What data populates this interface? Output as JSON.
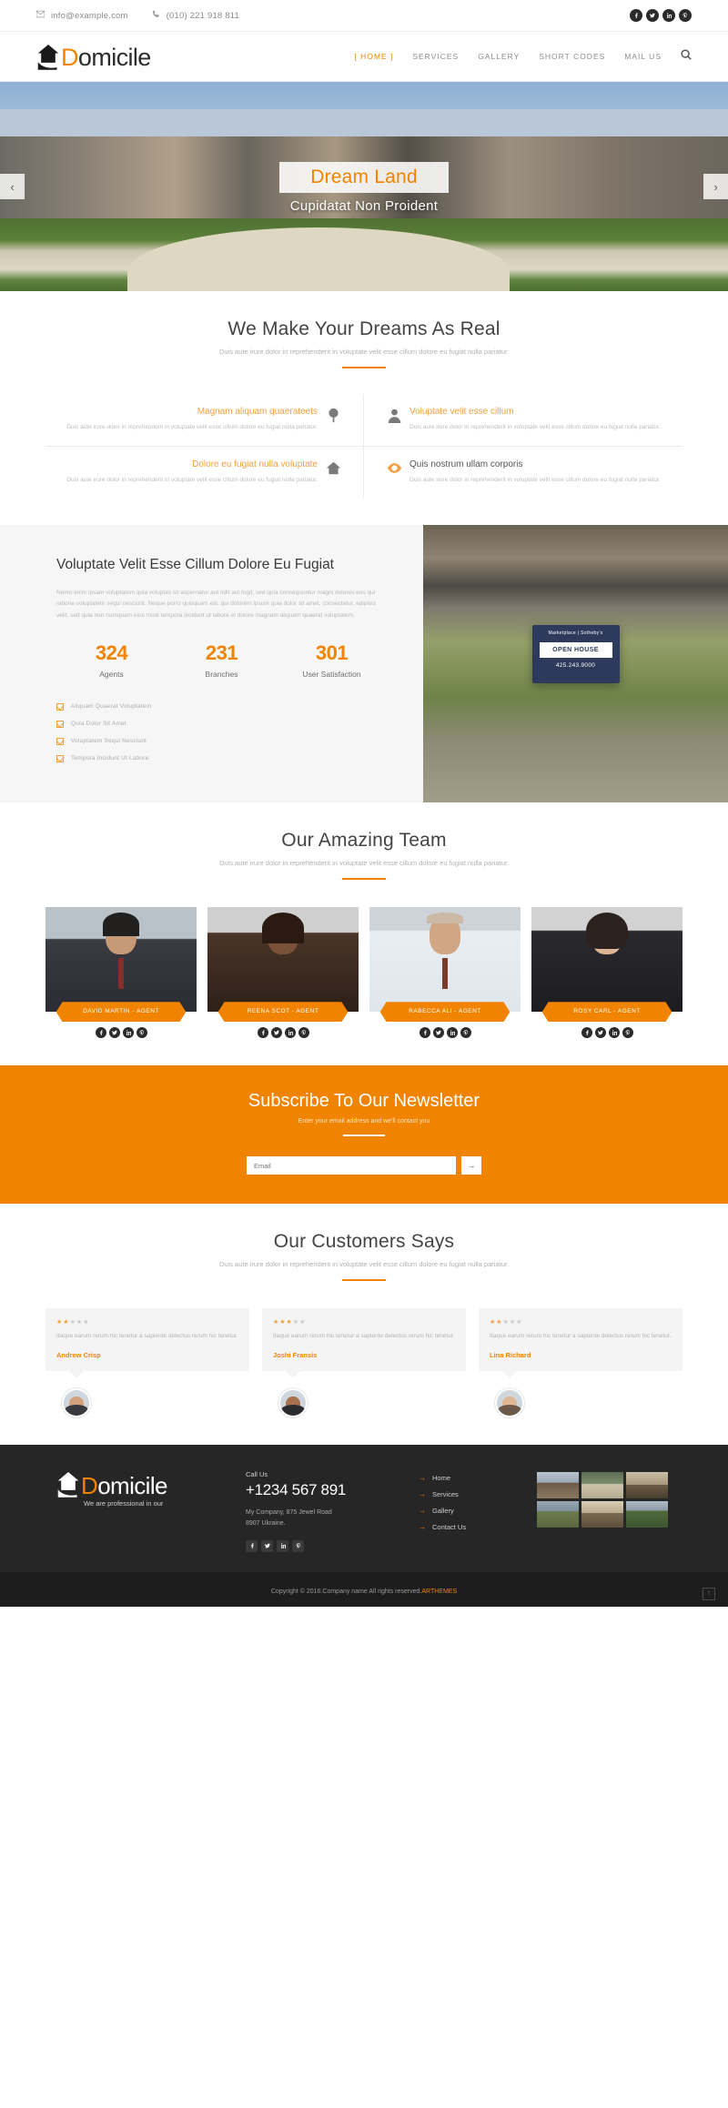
{
  "topbar": {
    "email": "info@example.com",
    "phone": "(010) 221 918 811",
    "socials": [
      "facebook-icon",
      "twitter-icon",
      "linkedin-icon",
      "pinterest-icon"
    ]
  },
  "header": {
    "logo_d": "D",
    "logo_rest": "omicile",
    "nav": [
      {
        "label": "[ HOME ]",
        "active": true
      },
      {
        "label": "SERVICES",
        "active": false
      },
      {
        "label": "GALLERY",
        "active": false
      },
      {
        "label": "SHORT CODES",
        "active": false
      },
      {
        "label": "MAIL US",
        "active": false
      }
    ],
    "search_icon": "search-icon"
  },
  "hero": {
    "title": "Dream Land",
    "subtitle": "Cupidatat Non Proident",
    "prev": "‹",
    "next": "›"
  },
  "services": {
    "title": "We Make Your Dreams As Real",
    "subtitle": "Duis aute irure dolor in reprehenderit in voluptate velit esse cillum dolore eu fugiat nulla pariatur.",
    "items": [
      {
        "title": "Magnam aliquam quaerateets",
        "desc": "Duis aute irure dolor in reprehenderit in voluptate velit esse cillum dolore eu fugiat nulla pariatur.",
        "icon": "tree-icon"
      },
      {
        "title": "Voluptate velit esse cillum",
        "desc": "Duis aute irure dolor in reprehenderit in voluptate velit esse cillum dolore eu fugiat nulla pariatur.",
        "icon": "user-icon"
      },
      {
        "title": "Dolore eu fugiat nulla voluptate",
        "desc": "Duis aute irure dolor in reprehenderit in voluptate velit esse cillum dolore eu fugiat nulla pariatur.",
        "icon": "home-icon"
      },
      {
        "title": "Quis nostrum ullam corporis",
        "desc": "Duis aute irure dolor in reprehenderit in voluptate velit esse cillum dolore eu fugiat nulla pariatur.",
        "icon": "eye-icon"
      }
    ]
  },
  "about": {
    "title": "Voluptate Velit Esse Cillum Dolore Eu Fugiat",
    "desc": "Nemo enim ipsam voluptatem quia voluptas sit aspernatur aut odit aut fugit, sed quia consequuntur magni dolores eos qui ratione voluptatem sequi nesciunt. Neque porro quisquam est, qui dolorem ipsum quia dolor sit amet, consectetur, adipisci velit, sed quia non numquam eius modi tempora incidunt ut labore et dolore magnam aliquam quaerat voluptatem.",
    "counters": [
      {
        "num": "324",
        "label": "Agents"
      },
      {
        "num": "231",
        "label": "Branches"
      },
      {
        "num": "301",
        "label": "User Satisfaction"
      }
    ],
    "checks": [
      "Aliquam Quaerat Voluptatem",
      "Quia Dolor Sit Amet",
      "Voluptatem Sequi Nesciunt",
      "Tempora Incidunt Ut Labore"
    ],
    "sign": {
      "brand": "Marketplace | Sotheby's",
      "headline": "OPEN HOUSE",
      "phone": "425.243.9000"
    }
  },
  "team": {
    "title": "Our Amazing Team",
    "subtitle": "Duis aute irure dolor in reprehenderit in voluptate velit esse cillum dolore eu fugiat nulla pariatur.",
    "members": [
      {
        "name": "DAVID MARTIN - AGENT"
      },
      {
        "name": "REENA SCOT - AGENT"
      },
      {
        "name": "RABECCA ALI - AGENT"
      },
      {
        "name": "ROSY CARL - AGENT"
      }
    ],
    "socials": [
      "facebook-icon",
      "twitter-icon",
      "linkedin-icon",
      "pinterest-icon"
    ]
  },
  "newsletter": {
    "title": "Subscribe To Our Newsletter",
    "subtitle": "Enter your email address and we'll contact you",
    "placeholder": "Email",
    "submit": "→"
  },
  "testimonials": {
    "title": "Our Customers Says",
    "subtitle": "Duis aute irure dolor in reprehenderit in voluptate velit esse cillum dolore eu fugiat nulla pariatur.",
    "items": [
      {
        "stars_on": 2,
        "stars_total": 5,
        "text": "Itaque earum rerum hic tenetur a sapiente delectus rerum hic tenetur.",
        "name": "Andrew Crisp"
      },
      {
        "stars_on": 3,
        "stars_total": 5,
        "text": "Itaque earum rerum hic tenetur a sapiente delectus rerum hic tenetur.",
        "name": "Joshi Fransis"
      },
      {
        "stars_on": 2,
        "stars_total": 5,
        "text": "Itaque earum rerum hic tenetur a sapiente delectus rerum hic tenetur.",
        "name": "Lina Richard"
      }
    ]
  },
  "footer": {
    "logo_d": "D",
    "logo_rest": "omicile",
    "tagline": "We are professional in our",
    "call_label": "Call Us",
    "phone": "+1234 567 891",
    "address_line1": "My Company, 875 Jewel Road",
    "address_line2": "8907 Ukraine.",
    "socials": [
      "facebook-icon",
      "twitter-icon",
      "linkedin-icon",
      "pinterest-icon"
    ],
    "links": [
      "Home",
      "Services",
      "Gallery",
      "Contact Us"
    ],
    "arrow": "→",
    "gallery_count": 6
  },
  "copyright": {
    "text": "Copyright © 2016.Company name All rights reserved.",
    "link": "ARTHEMES",
    "scrolltop": "↑"
  },
  "colors": {
    "accent": "#f08400",
    "dark": "#262626",
    "darker": "#1d1d1d"
  }
}
